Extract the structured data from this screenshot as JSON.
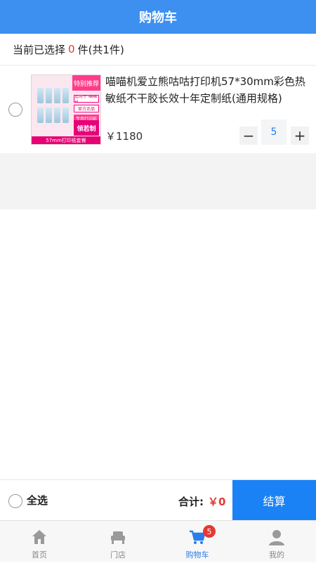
{
  "header": {
    "title": "购物车"
  },
  "selection": {
    "prefix": "当前已选择",
    "count": "0",
    "suffix": "件(共1件)"
  },
  "item": {
    "title": "喵喵机爱立熊咕咕打印机57*30mm彩色热敏纸不干胶长效十年定制纸(通用规格)",
    "price": "￥1180",
    "quantity": "5",
    "minus": "−",
    "plus": "+",
    "image": {
      "promo": "特别推荐",
      "tags": [
        "适用于:喵喵机",
        "官方正品",
        "专用打印纸"
      ],
      "seal": "领若制",
      "banner": "57mm打印纸套餐"
    }
  },
  "footer": {
    "select_all": "全选",
    "total_label": "合计:",
    "total_value": "￥0",
    "checkout": "结算"
  },
  "tabs": [
    {
      "label": "首页",
      "icon": "home-icon"
    },
    {
      "label": "门店",
      "icon": "store-icon"
    },
    {
      "label": "购物车",
      "icon": "cart-icon",
      "badge": "5"
    },
    {
      "label": "我的",
      "icon": "user-icon"
    }
  ],
  "colors": {
    "brand": "#3d8ff0",
    "checkout": "#1a82f5",
    "accent_red": "#e53935",
    "active_tab": "#2b7de9"
  }
}
